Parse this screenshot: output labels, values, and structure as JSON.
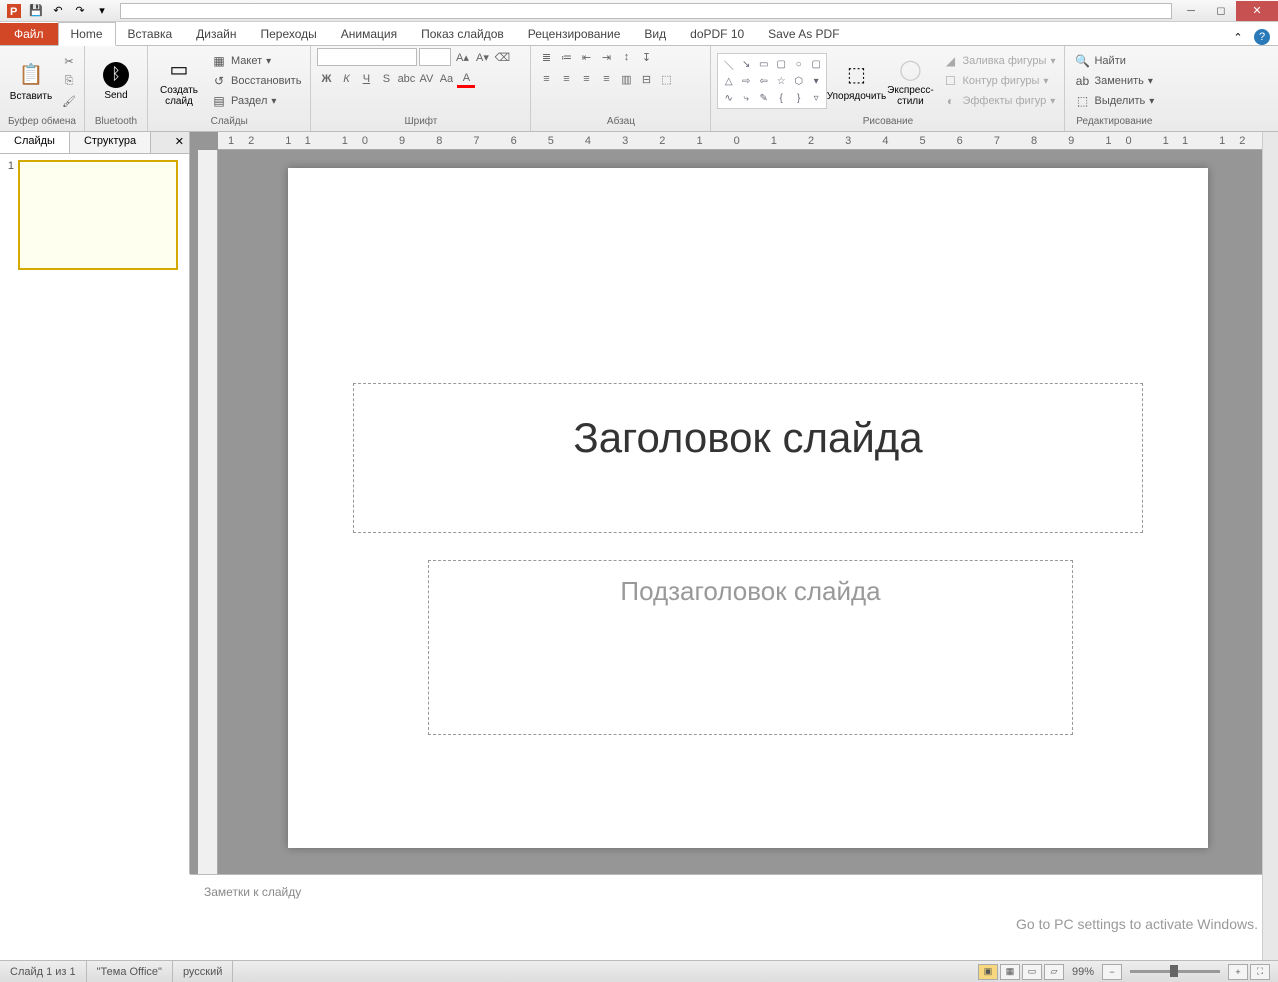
{
  "tabs": {
    "file": "Файл",
    "home": "Home",
    "insert": "Вставка",
    "design": "Дизайн",
    "transitions": "Переходы",
    "animations": "Анимация",
    "slideshow": "Показ слайдов",
    "review": "Рецензирование",
    "view": "Вид",
    "dopdf": "doPDF 10",
    "savepdf": "Save As PDF"
  },
  "ribbon": {
    "clipboard": {
      "paste": "Вставить",
      "label": "Буфер обмена"
    },
    "bluetooth": {
      "send": "Send",
      "label": "Bluetooth"
    },
    "slides": {
      "new": "Создать слайд",
      "layout": "Макет",
      "reset": "Восстановить",
      "section": "Раздел",
      "label": "Слайды"
    },
    "font": {
      "label": "Шрифт"
    },
    "paragraph": {
      "label": "Абзац"
    },
    "drawing": {
      "arrange": "Упорядочить",
      "styles": "Экспресс-стили",
      "fill": "Заливка фигуры",
      "outline": "Контур фигуры",
      "effects": "Эффекты фигур",
      "label": "Рисование"
    },
    "editing": {
      "find": "Найти",
      "replace": "Заменить",
      "select": "Выделить",
      "label": "Редактирование"
    }
  },
  "panes": {
    "slides": "Слайды",
    "outline": "Структура"
  },
  "slide": {
    "num": "1",
    "title": "Заголовок слайда",
    "subtitle": "Подзаголовок слайда"
  },
  "notes": {
    "placeholder": "Заметки к слайду"
  },
  "status": {
    "slide": "Слайд 1 из 1",
    "theme": "\"Тема Office\"",
    "lang": "русский",
    "zoom": "99%"
  },
  "watermark": {
    "text": "Go to PC settings to activate Windows."
  }
}
